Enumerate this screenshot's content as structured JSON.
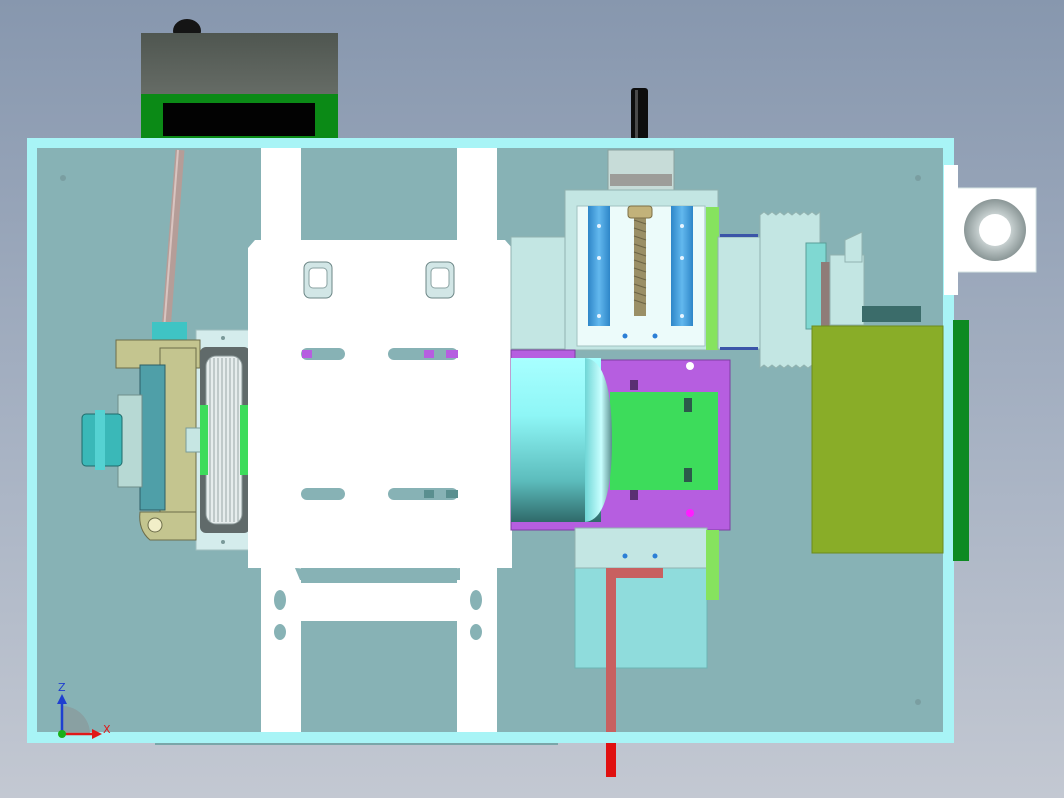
{
  "viewport": {
    "background_top": "#8797ae",
    "background_bottom": "#c3c8d2"
  },
  "triad": {
    "z_label": "Z",
    "x_label": "X",
    "z_color": "#1f3fd0",
    "x_color": "#e01818",
    "y_color": "#19b019"
  },
  "colors": {
    "frame_edge": "#9ff1f4",
    "panel": "#86b1b5",
    "mount_plate": "#ffffff",
    "motor_body": "#7fe4e4",
    "magenta_housing": "#b65ee0",
    "green_block": "#3ddc5b",
    "olive_box": "#89ad28",
    "dark_green_rail": "#0d8a22",
    "blue_rail": "#3d98d6",
    "red_rod": "#e01010",
    "rose_rod": "#c86060"
  },
  "icons": [
    "z-axis-arrow-icon",
    "x-axis-arrow-icon",
    "origin-icon"
  ]
}
